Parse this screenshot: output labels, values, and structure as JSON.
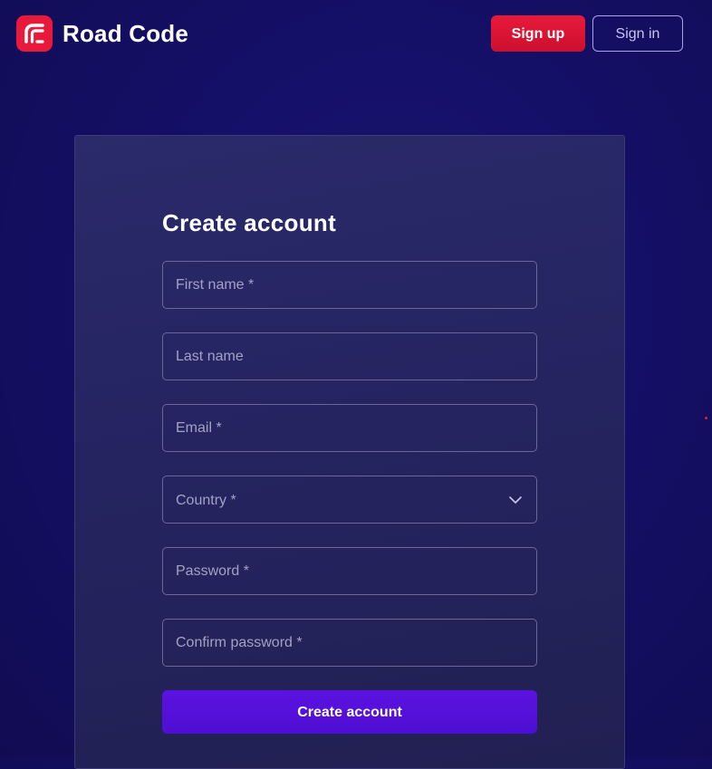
{
  "brand": {
    "name": "Road Code",
    "logo_icon": "road-code-logo-icon",
    "accent_color": "#e8193a"
  },
  "header": {
    "signup_label": "Sign up",
    "signin_label": "Sign in"
  },
  "form": {
    "title": "Create account",
    "fields": {
      "first_name": {
        "placeholder": "First name *",
        "value": ""
      },
      "last_name": {
        "placeholder": "Last name",
        "value": ""
      },
      "email": {
        "placeholder": "Email *",
        "value": ""
      },
      "country": {
        "placeholder": "Country *",
        "value": "",
        "icon": "chevron-down-icon"
      },
      "password": {
        "placeholder": "Password *",
        "value": ""
      },
      "confirm_password": {
        "placeholder": "Confirm password *",
        "value": ""
      }
    },
    "submit_label": "Create account",
    "submit_color": "#5b12e0"
  }
}
